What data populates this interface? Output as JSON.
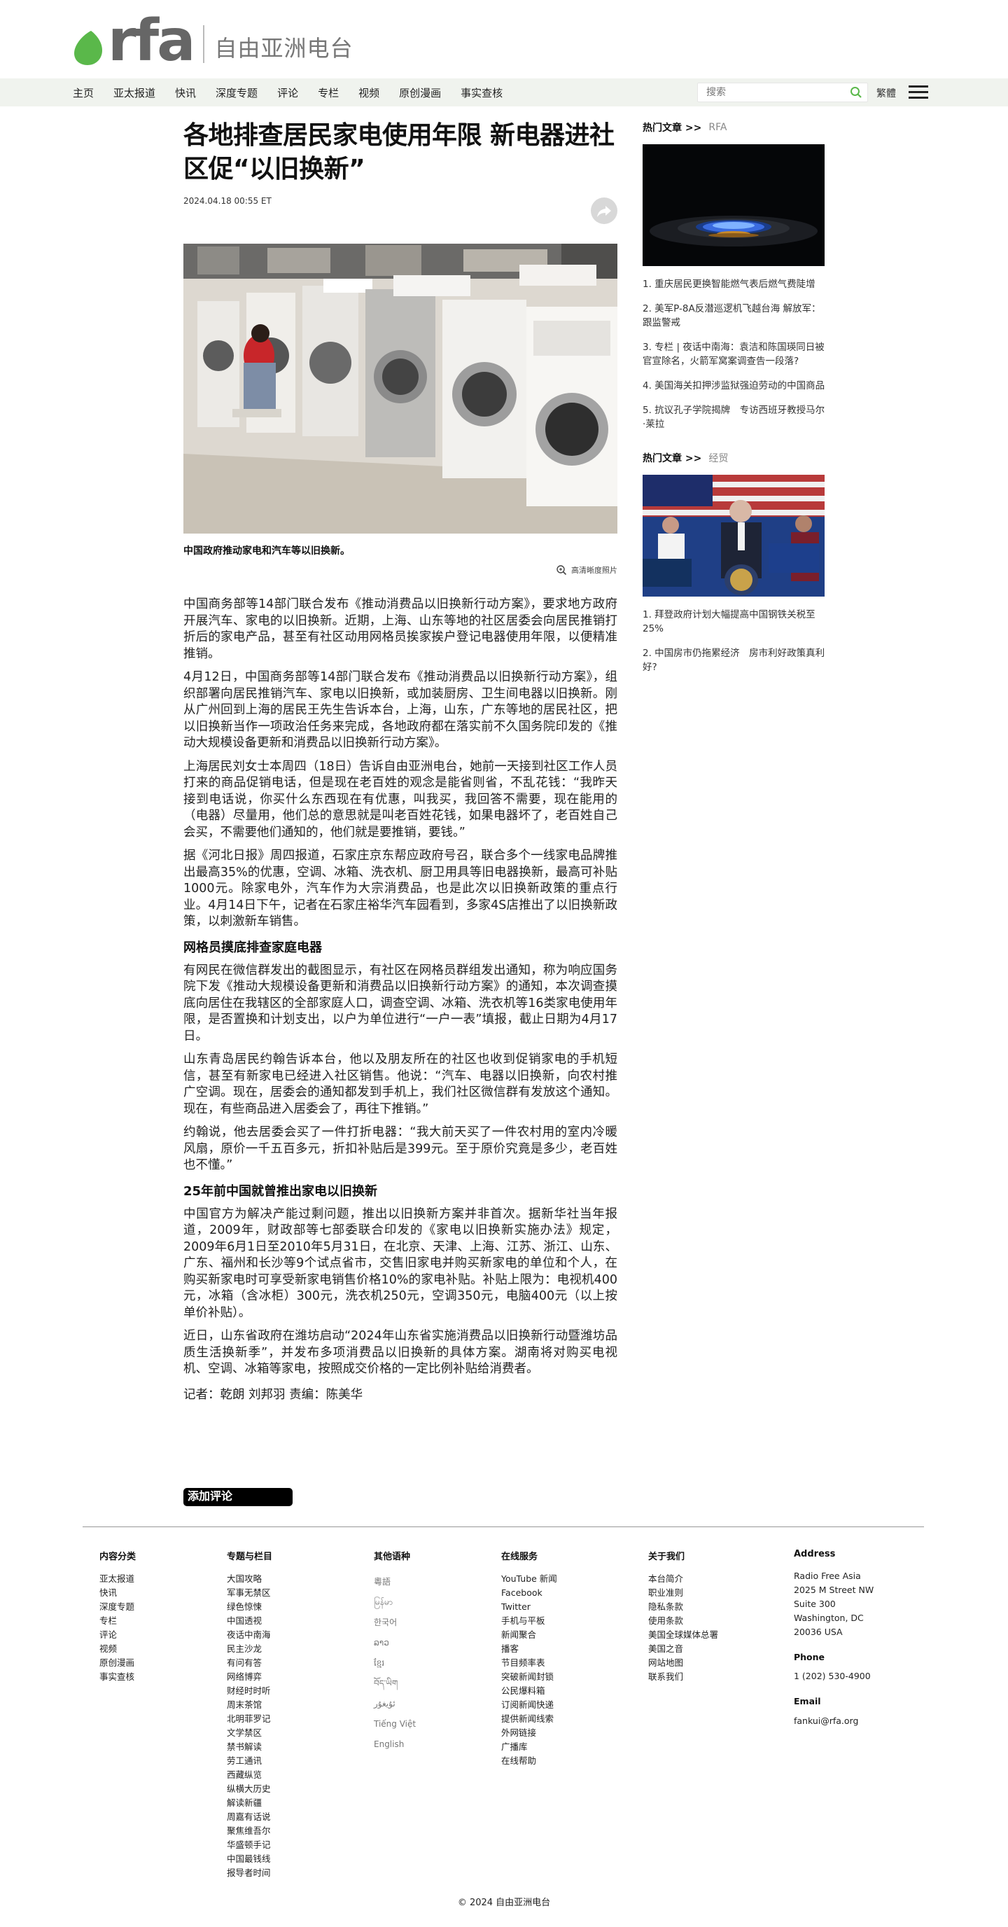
{
  "brand": {
    "logo_text": "rfa",
    "site_name": "自由亚洲电台"
  },
  "nav": {
    "items": [
      "主页",
      "亚太报道",
      "快讯",
      "深度专题",
      "评论",
      "专栏",
      "视频",
      "原创漫画",
      "事实查核"
    ],
    "search_placeholder": "搜索",
    "lang_toggle": "繁體"
  },
  "article": {
    "title": "各地排查居民家电使用年限 新电器进社区促“以旧换新”",
    "date": "2024.04.18 00:55 ET",
    "photo_caption": "中国政府推动家电和汽车等以旧换新。",
    "hires_label": "高清晰度照片",
    "paragraphs_1": [
      "中国商务部等14部门联合发布《推动消费品以旧换新行动方案》，要求地方政府开展汽车、家电的以旧换新。近期，上海、山东等地的社区居委会向居民推销打折后的家电产品，甚至有社区动用网格员挨家挨户登记电器使用年限，以便精准推销。",
      "4月12日，中国商务部等14部门联合发布《推动消费品以旧换新行动方案》，组织部署向居民推销汽车、家电以旧换新，或加装厨房、卫生间电器以旧换新。刚从广州回到上海的居民王先生告诉本台，上海，山东，广东等地的居民社区，把以旧换新当作一项政治任务来完成，各地政府都在落实前不久国务院印发的《推动大规模设备更新和消费品以旧换新行动方案》。",
      "上海居民刘女士本周四（18日）告诉自由亚洲电台，她前一天接到社区工作人员打来的商品促销电话，但是现在老百姓的观念是能省则省，不乱花钱：“我昨天接到电话说，你买什么东西现在有优惠，叫我买，我回答不需要，现在能用的（电器）尽量用，他们总的意思就是叫老百姓花钱，如果电器坏了，老百姓自己会买，不需要他们通知的，他们就是要推销，要钱。”",
      "据《河北日报》周四报道，石家庄京东帮应政府号召，联合多个一线家电品牌推出最高35%的优惠，空调、冰箱、洗衣机、厨卫用具等旧电器换新，最高可补贴1000元。除家电外，汽车作为大宗消费品，也是此次以旧换新政策的重点行业。4月14日下午，记者在石家庄裕华汽车园看到，多家4S店推出了以旧换新政策，以刺激新车销售。"
    ],
    "subhead_1": "网格员摸底排查家庭电器",
    "paragraphs_2": [
      "有网民在微信群发出的截图显示，有社区在网格员群组发出通知，称为响应国务院下发《推动大规模设备更新和消费品以旧换新行动方案》的通知，本次调查摸底向居住在我辖区的全部家庭人口，调查空调、冰箱、洗衣机等16类家电使用年限，是否置换和计划支出，以户为单位进行“一户一表”填报，截止日期为4月17日。",
      "山东青岛居民约翰告诉本台，他以及朋友所在的社区也收到促销家电的手机短信，甚至有新家电已经进入社区销售。他说：“汽车、电器以旧换新，向农村推广空调。现在，居委会的通知都发到手机上，我们社区微信群有发放这个通知。现在，有些商品进入居委会了，再往下推销。”",
      "约翰说，他去居委会买了一件打折电器：“我大前天买了一件农村用的室内冷暖风扇，原价一千五百多元，折扣补贴后是399元。至于原价究竟是多少，老百姓也不懂。”"
    ],
    "subhead_2": "25年前中国就曾推出家电以旧换新",
    "paragraphs_3": [
      "中国官方为解决产能过剩问题，推出以旧换新方案并非首次。据新华社当年报道，2009年，财政部等七部委联合印发的《家电以旧换新实施办法》规定，2009年6月1日至2010年5月31日，在北京、天津、上海、江苏、浙江、山东、广东、福州和长沙等9个试点省市，交售旧家电并购买新家电的单位和个人，在购买新家电时可享受新家电销售价格10%的家电补贴。补贴上限为：电视机400元，冰箱（含冰柜）300元，洗衣机250元，空调350元，电脑400元（以上按单价补贴）。",
      "近日，山东省政府在潍坊启动“2024年山东省实施消费品以旧换新行动暨潍坊品质生活换新季”，并发布多项消费品以旧换新的具体方案。湖南将对购买电视机、空调、冰箱等家电，按照成交价格的一定比例补贴给消费者。"
    ],
    "byline": "记者：乾朗 刘邦羽 责编：陈美华",
    "comment_button": "添加评论"
  },
  "sidebar": {
    "block1": {
      "heading": "热门文章 >>",
      "source": "RFA",
      "items": [
        "1. 重庆居民更换智能燃气表后燃气费陡增",
        "2. 美军P-8A反潜巡逻机飞越台海 解放军：跟监警戒",
        "3. 专栏 | 夜话中南海：袁洁和陈国瑛同日被官宣除名，火箭军窝案调查告一段落?",
        "4. 美国海关扣押涉监狱强迫劳动的中国商品",
        "5. 抗议孔子学院揭牌　专访西班牙教授马尔·莱拉"
      ]
    },
    "block2": {
      "heading": "热门文章 >>",
      "source": "经贸",
      "items": [
        "1. 拜登政府计划大幅提高中国钢铁关税至25%",
        "2. 中国房市仍拖累经济　房市利好政策真利好?"
      ]
    }
  },
  "footer": {
    "col1": {
      "heading": "内容分类",
      "items": [
        "亚太报道",
        "快讯",
        "深度专题",
        "专栏",
        "评论",
        "视频",
        "原创漫画",
        "事实查核"
      ]
    },
    "col2": {
      "heading": "专题与栏目",
      "items": [
        "大国攻略",
        "军事无禁区",
        "绿色惊悚",
        "中国透视",
        "夜话中南海",
        "民主沙龙",
        "有问有答",
        "网络博弈",
        "财经时时听",
        "周末茶馆",
        "北明菲罗记",
        "文学禁区",
        "禁书解读",
        "劳工通讯",
        "西藏纵览",
        "纵横大历史",
        "解读新疆",
        "周嘉有话说",
        "聚焦维吾尔",
        "华盛顿手记",
        "中国最钱线",
        "报导者时间"
      ]
    },
    "col3": {
      "heading": "其他语种",
      "items": [
        "粵語",
        "မြန်မာ",
        "한국어",
        "ລາວ",
        "ខ្មែរ",
        "བོད་ཡིག",
        "ئۇيغۇر",
        "Tiếng Việt",
        "English"
      ]
    },
    "col4": {
      "heading": "在线服务",
      "items": [
        "YouTube 新闻",
        "Facebook",
        "Twitter",
        "手机与平板",
        "新闻聚合",
        "播客",
        "节目频率表",
        "突破新闻封锁",
        "公民爆料箱",
        "订阅新闻快递",
        "提供新闻线索",
        "外网链接",
        "广播库",
        "在线帮助"
      ]
    },
    "col5": {
      "heading": "关于我们",
      "items": [
        "本台简介",
        "职业准则",
        "隐私条款",
        "使用条款",
        "美国全球媒体总署",
        "美国之音",
        "网站地图",
        "联系我们"
      ]
    },
    "col6": {
      "heading": "Address",
      "address": [
        "Radio Free Asia",
        "2025 M Street NW",
        "Suite 300",
        "Washington, DC",
        "20036 USA"
      ],
      "phone_label": "Phone",
      "phone": "1 (202) 530-4900",
      "email_label": "Email",
      "email": "fankui@rfa.org"
    },
    "copyright": "© 2024 自由亚洲电台"
  },
  "colors": {
    "brand_green": "#5ab84a",
    "nav_bg": "#f0f3ee"
  }
}
